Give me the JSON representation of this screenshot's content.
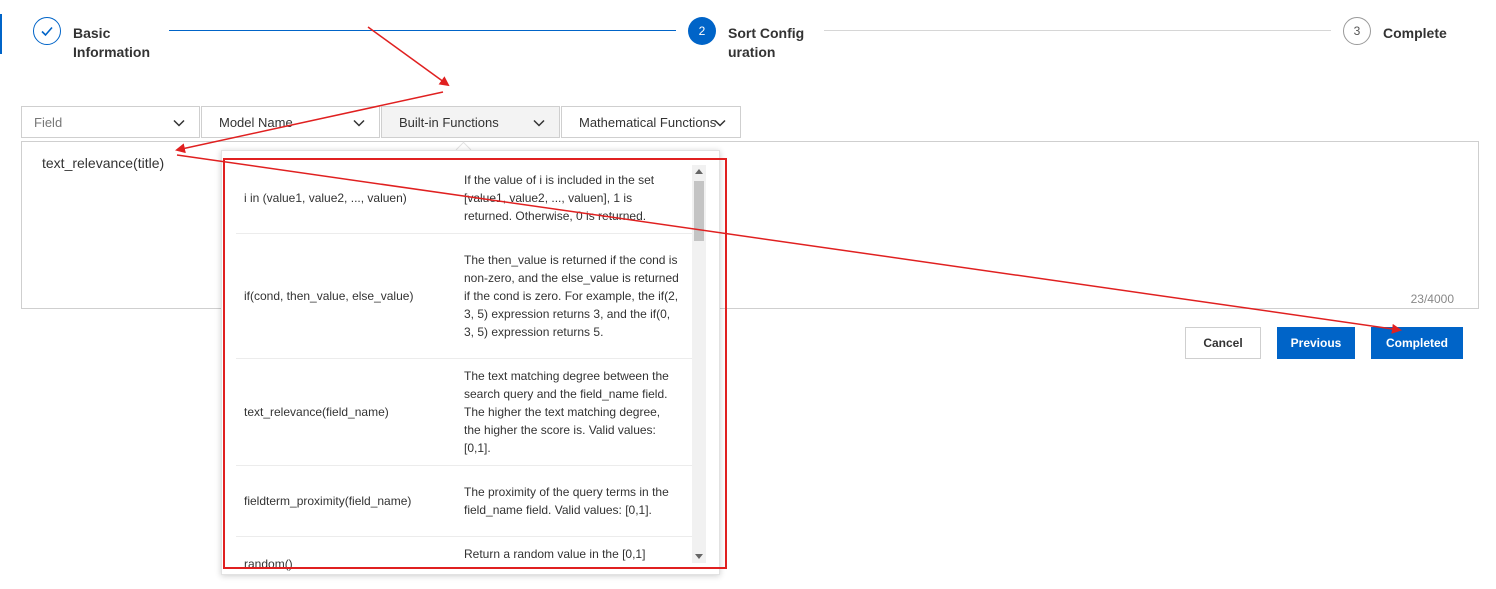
{
  "stepper": {
    "steps": [
      {
        "number": "",
        "label": "Basic Information",
        "state": "done"
      },
      {
        "number": "2",
        "label": "Sort Configuration",
        "state": "active"
      },
      {
        "number": "3",
        "label": "Complete",
        "state": "pending"
      }
    ]
  },
  "selectors": {
    "field": {
      "placeholder": "Field",
      "icon": "chevron-down-icon"
    },
    "model_name": {
      "label": "Model Name",
      "icon": "chevron-down-icon"
    },
    "builtin_functions": {
      "label": "Built-in Functions",
      "icon": "chevron-down-icon"
    },
    "math_functions": {
      "label": "Mathematical Functions",
      "icon": "chevron-down-icon"
    }
  },
  "editor": {
    "expression": "text_relevance(title)",
    "char_count": "23/4000"
  },
  "function_list": [
    {
      "name": "i in (value1, value2, ..., valuen)",
      "description": "If the value of i is included in the set [value1, value2, ..., valuen], 1 is returned. Otherwise, 0 is returned."
    },
    {
      "name": "if(cond, then_value, else_value)",
      "description": "The then_value is returned if the cond is non-zero, and the else_value is returned if the cond is zero. For example, the if(2, 3, 5) expression returns 3, and the if(0, 3, 5) expression returns 5."
    },
    {
      "name": "text_relevance(field_name)",
      "description": "The text matching degree between the search query and the field_name field. The higher the text matching degree, the higher the score is. Valid values: [0,1]."
    },
    {
      "name": "fieldterm_proximity(field_name)",
      "description": "The proximity of the query terms in the field_name field. Valid values: [0,1]."
    },
    {
      "name": "random()",
      "description": "Return a random value in the [0,1]"
    }
  ],
  "actions": {
    "cancel": "Cancel",
    "previous": "Previous",
    "completed": "Completed"
  },
  "colors": {
    "primary": "#0064c8",
    "annotation": "#e02020",
    "border": "#cfcfcf"
  }
}
